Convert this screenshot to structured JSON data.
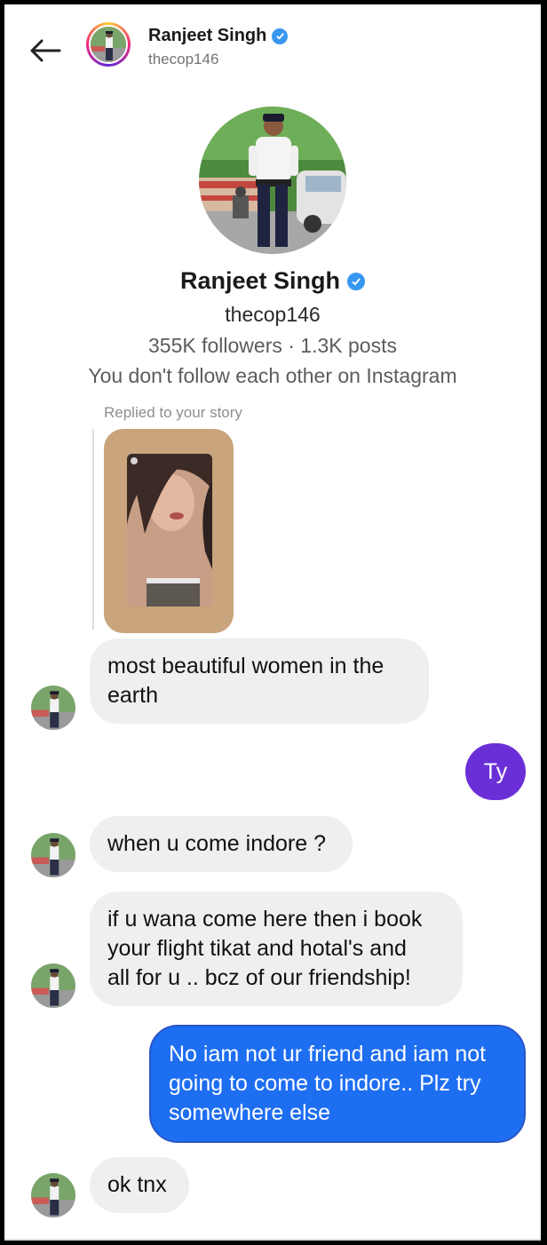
{
  "header": {
    "name": "Ranjeet Singh",
    "handle": "thecop146",
    "back_icon": "arrow-left-icon",
    "verified_icon": "verified-badge-icon"
  },
  "profile": {
    "name": "Ranjeet Singh",
    "handle": "thecop146",
    "stats": "355K followers · 1.3K posts",
    "mutual": "You don't follow each other on Instagram"
  },
  "story_reply": {
    "label": "Replied to your story"
  },
  "messages": [
    {
      "sender": "them",
      "text_lines": [
        "most beautiful women in the",
        "earth"
      ]
    },
    {
      "sender": "me",
      "text_lines": [
        "Ty"
      ]
    },
    {
      "sender": "them",
      "text_lines": [
        "when u come indore ?"
      ]
    },
    {
      "sender": "them",
      "text_lines": [
        "if u wana come here then i book",
        "your flight tikat and hotal's and",
        "all  for u .. bcz of our friendship!"
      ]
    },
    {
      "sender": "me",
      "text_lines": [
        "No iam not ur friend and iam not",
        "going to come to indore.. Plz try",
        "somewhere else"
      ]
    },
    {
      "sender": "them",
      "text_lines": [
        "ok tnx"
      ]
    }
  ],
  "colors": {
    "incoming_bubble": "#efeff2",
    "outgoing_purple": "#6b2fd8",
    "outgoing_blue": "#1e6ef2",
    "verified": "#3897f0"
  }
}
